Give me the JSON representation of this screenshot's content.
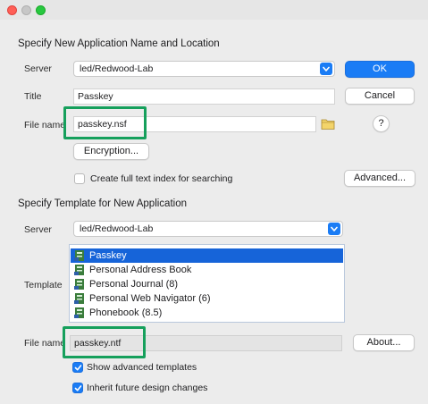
{
  "section1": {
    "title": "Specify New Application Name and Location",
    "server_label": "Server",
    "server_value": "led/Redwood-Lab",
    "title_label": "Title",
    "title_value": "Passkey",
    "filename_label": "File name",
    "filename_value": "passkey.nsf",
    "encryption_button": "Encryption...",
    "fulltext_checkbox_label": "Create full text index for searching",
    "fulltext_checked": false,
    "advanced_button": "Advanced..."
  },
  "dialog_buttons": {
    "ok": "OK",
    "cancel": "Cancel",
    "help": "?"
  },
  "section2": {
    "title": "Specify Template for New Application",
    "server_label": "Server",
    "server_value": "led/Redwood-Lab",
    "template_label": "Template",
    "templates": [
      {
        "label": "Passkey",
        "selected": true
      },
      {
        "label": "Personal Address Book",
        "selected": false
      },
      {
        "label": "Personal Journal (8)",
        "selected": false
      },
      {
        "label": "Personal Web Navigator (6)",
        "selected": false
      },
      {
        "label": "Phonebook (8.5)",
        "selected": false
      }
    ],
    "filename_label": "File name",
    "filename_value": "passkey.ntf",
    "about_button": "About...",
    "show_advanced_label": "Show advanced templates",
    "show_advanced_checked": true,
    "inherit_label": "Inherit future design changes",
    "inherit_checked": true
  },
  "colors": {
    "accent": "#1a7cf5",
    "highlight_box": "#16a05c",
    "list_selection": "#1664d9"
  },
  "icons": {
    "template_item": "notes-database-icon",
    "folder": "folder-icon",
    "dropdown": "chevron-updown-icon"
  }
}
